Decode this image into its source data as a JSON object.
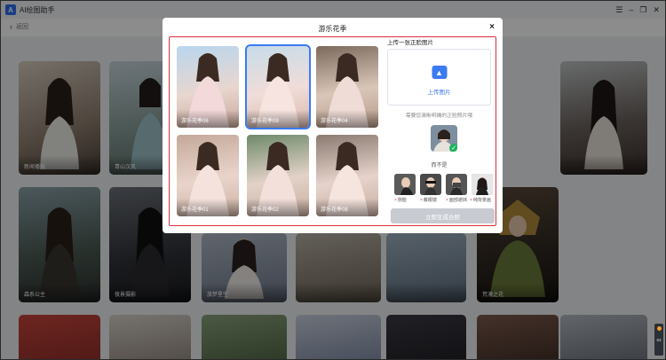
{
  "window": {
    "title": "AI绘图助手",
    "controls": [
      "☰",
      "–",
      "❐",
      "✕"
    ]
  },
  "nav": {
    "back_label": "返回"
  },
  "background_cards": [
    "新闻播报",
    "青山汉风",
    "",
    "",
    "",
    "",
    "",
    "",
    "",
    "",
    "森系公主",
    "夜景摄影",
    "旅梦星空",
    "",
    "",
    "荒漠之花",
    "",
    "",
    "",
    "",
    "",
    "",
    "",
    ""
  ],
  "modal": {
    "title": "游乐花季",
    "close": "×",
    "thumbnails": [
      {
        "label": "游乐花季06",
        "selected": false
      },
      {
        "label": "游乐花季09",
        "selected": true
      },
      {
        "label": "游乐花季04",
        "selected": false
      },
      {
        "label": "游乐花季01",
        "selected": false
      },
      {
        "label": "游乐花季02",
        "selected": false
      },
      {
        "label": "游乐花季08",
        "selected": false
      }
    ],
    "upload": {
      "heading": "上传一张正脸图片",
      "button": "上传图片"
    },
    "hint": "需要您清晰明确的正脸照片哦",
    "bad_heading": "而不是",
    "bad_examples": [
      "侧脸",
      "戴眼镜",
      "面部遮挡",
      "纯背景画"
    ],
    "generate": "立即生成合照"
  },
  "colors": {
    "accent": "#3a7bf2",
    "border_highlight": "#d9303a",
    "disabled_button": "#c8ccd2",
    "good_check": "#21b35c"
  },
  "side_widget": {
    "label": "63"
  }
}
